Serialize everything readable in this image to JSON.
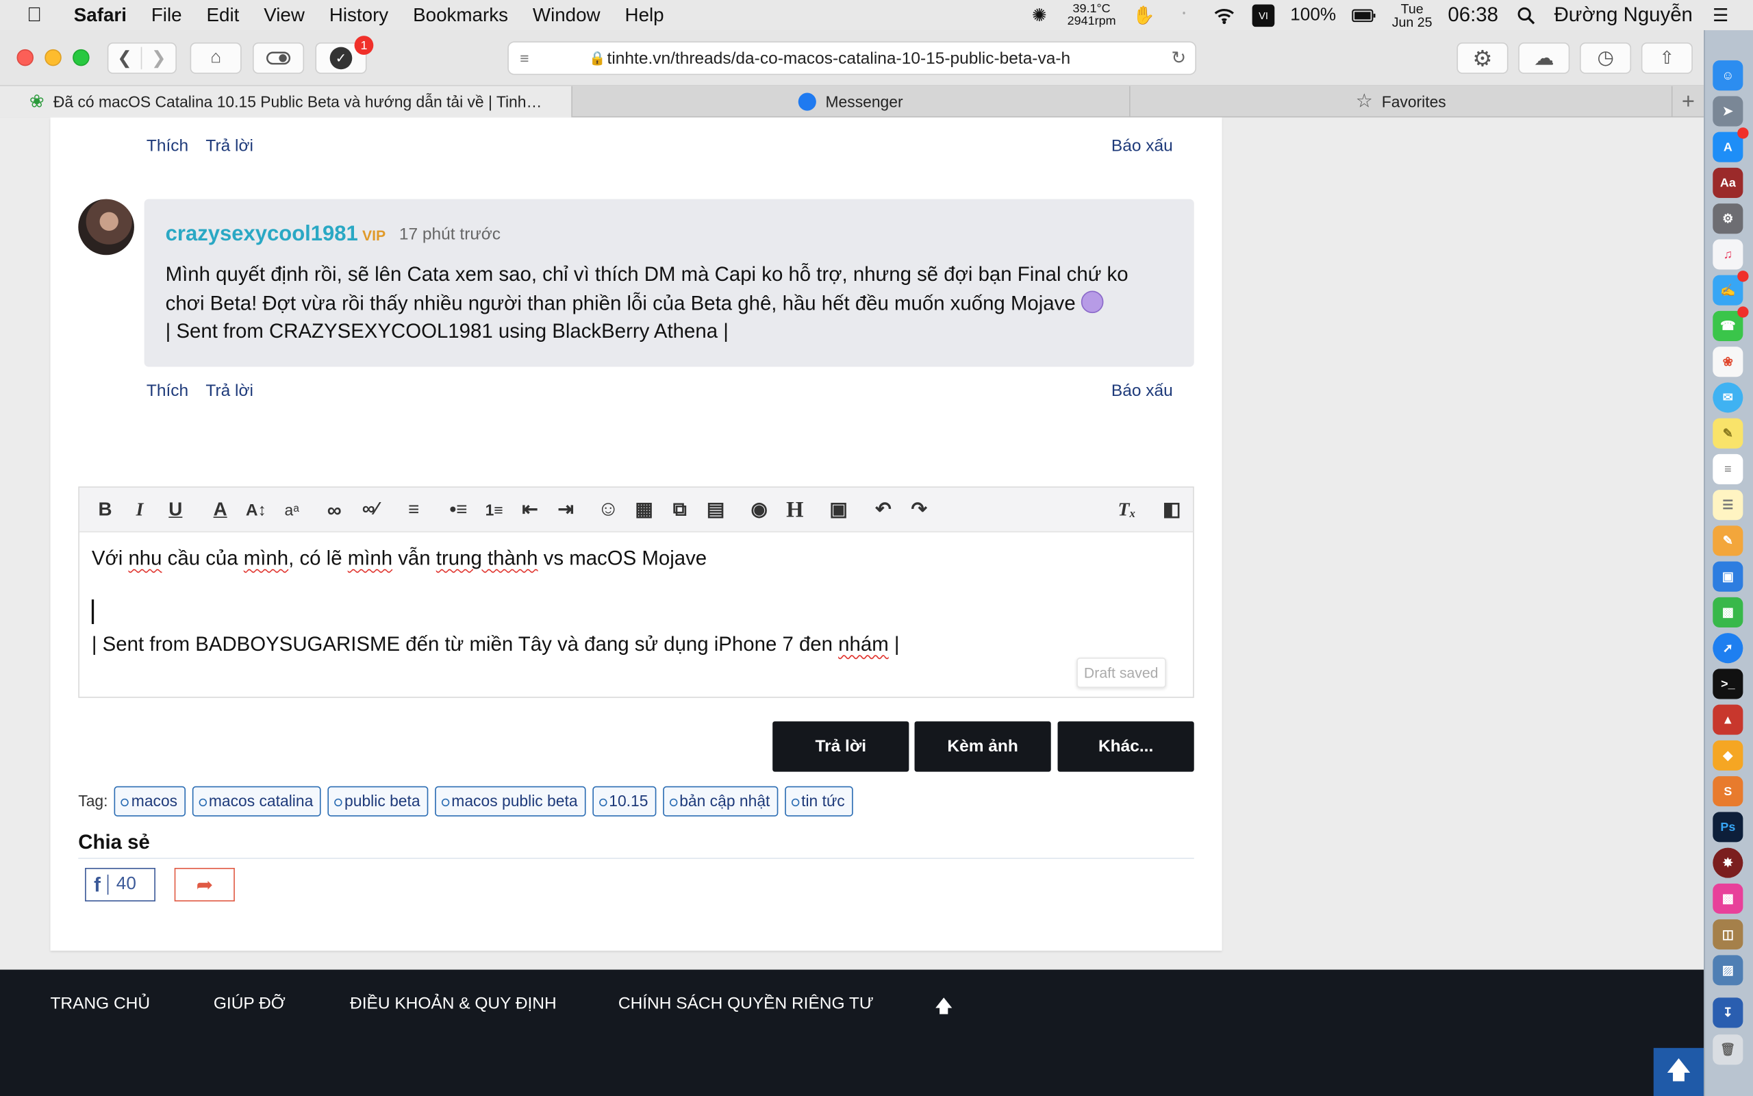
{
  "menubar": {
    "apple": "",
    "items": [
      "Safari",
      "File",
      "Edit",
      "View",
      "History",
      "Bookmarks",
      "Window",
      "Help"
    ],
    "temp": "39.1°C",
    "rpm": "2941rpm",
    "battery": "100%",
    "day": "Tue",
    "date": "Jun 25",
    "time": "06:38",
    "user": "Đường Nguyễn"
  },
  "toolbar": {
    "badge": "1",
    "url": "tinhte.vn/threads/da-co-macos-catalina-10-15-public-beta-va-h"
  },
  "tabs": [
    {
      "label": "Đã có macOS Catalina 10.15 Public Beta và hướng dẫn tải về | Tinh…",
      "icon": "tinhte-icon"
    },
    {
      "label": "Messenger",
      "icon": "messenger-icon"
    },
    {
      "label": "Favorites",
      "icon": "star-icon"
    }
  ],
  "post": {
    "actions_top": {
      "like": "Thích",
      "reply": "Trả lời",
      "report": "Báo xấu"
    },
    "comment": {
      "user": "crazysexycool1981",
      "badge": "VIP",
      "time": "17 phút trước",
      "line1": "Mình quyết định rồi, sẽ lên Cata xem sao, chỉ vì thích DM mà Capi ko hỗ trợ, nhưng sẽ đợi bạn Final chứ ko chơi Beta! Đợt vừa rồi thấy nhiều người than phiền lỗi của Beta ghê, hầu hết đều muốn xuống Mojave",
      "line2": "| Sent from CRAZYSEXYCOOL1981 using BlackBerry Athena |"
    },
    "actions_bottom": {
      "like": "Thích",
      "reply": "Trả lời",
      "report": "Báo xấu"
    }
  },
  "editor": {
    "line1_a": "Với ",
    "line1_b": "nhu",
    "line1_c": " cầu của ",
    "line1_d": "mình",
    "line1_e": ", có lẽ ",
    "line1_f": "mình",
    "line1_g": " vẫn ",
    "line1_h": "trung thành",
    "line1_i": " vs macOS Mojave",
    "line3_a": "| Sent from BADBOYSUGARISME đến từ miền Tây và đang sử dụng iPhone 7 đen ",
    "line3_b": "nhám",
    "line3_c": " |",
    "draft": "Draft saved"
  },
  "buttons": {
    "reply": "Trả lời",
    "attach": "Kèm ảnh",
    "more": "Khác..."
  },
  "tags": {
    "label": "Tag:",
    "items": [
      "macos",
      "macos catalina",
      "public beta",
      "macos public beta",
      "10.15",
      "bản cập nhật",
      "tin tức"
    ]
  },
  "share": {
    "title": "Chia sẻ",
    "fb_count": "40"
  },
  "footer": {
    "links": [
      "TRANG CHỦ",
      "GIÚP ĐỠ",
      "ĐIỀU KHOẢN & QUY ĐỊNH",
      "CHÍNH SÁCH QUYỀN RIÊNG TƯ"
    ]
  },
  "colors": {
    "username": "#2aa8c4",
    "vip": "#e09a2a",
    "link": "#1e3a7a",
    "footer_bg": "#14181f",
    "button_bg": "#14171c"
  }
}
